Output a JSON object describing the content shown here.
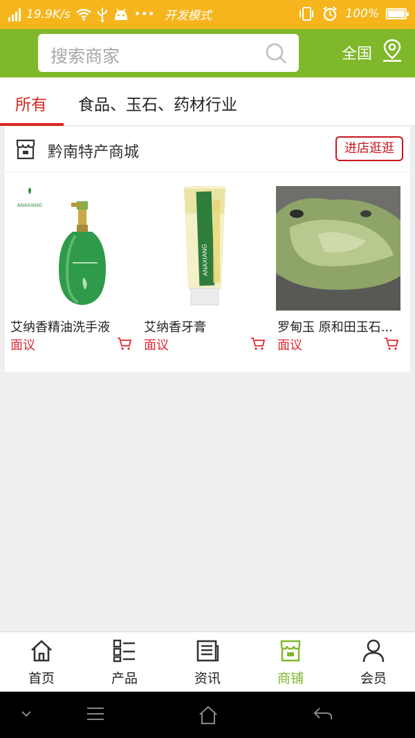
{
  "status_bar": {
    "speed": "19.9K/s",
    "dev_mode": "开发模式",
    "dots": "•••",
    "battery": "100%"
  },
  "header": {
    "search_placeholder": "搜索商家",
    "region": "全国"
  },
  "tabs": [
    {
      "label": "所有",
      "active": true
    },
    {
      "label": "食品、玉石、药材行业",
      "active": false
    }
  ],
  "store": {
    "name": "黔南特产商城",
    "enter_label": "进店逛逛",
    "products": [
      {
        "name": "艾纳香精油洗手液",
        "price": "面议",
        "brand": "ANAXIANG"
      },
      {
        "name": "艾纳香牙膏",
        "price": "面议",
        "brand": "ANAXIANG"
      },
      {
        "name": "罗甸玉 原和田玉石...",
        "price": "面议"
      }
    ]
  },
  "bottom_nav": [
    {
      "label": "首页",
      "icon": "home-icon",
      "active": false
    },
    {
      "label": "产品",
      "icon": "list-icon",
      "active": false
    },
    {
      "label": "资讯",
      "icon": "news-icon",
      "active": false
    },
    {
      "label": "商铺",
      "icon": "shop-icon",
      "active": true
    },
    {
      "label": "会员",
      "icon": "user-icon",
      "active": false
    }
  ],
  "colors": {
    "status_bar": "#f6b51c",
    "header": "#7fb82a",
    "accent_red": "#d9261c",
    "active_nav": "#7fb82a"
  }
}
